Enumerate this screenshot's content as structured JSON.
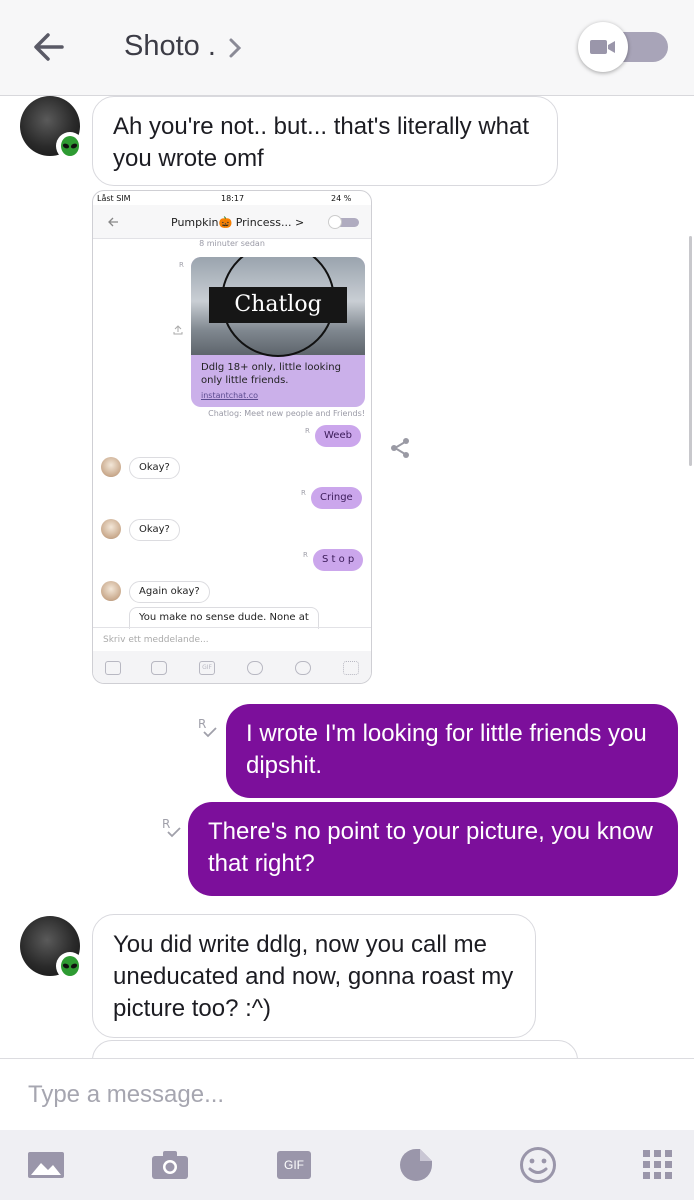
{
  "header": {
    "back_icon": "arrow-left-icon",
    "contact_name": "Shoto .",
    "chevron_icon": "chevron-right-icon",
    "video_toggle_icon": "video-camera-icon"
  },
  "messages": [
    {
      "side": "incoming",
      "text": "Ah you're not.. but... that's literally what you wrote omf"
    },
    {
      "side": "outgoing",
      "text": "I wrote I'm looking for little friends you dipshit."
    },
    {
      "side": "outgoing",
      "text": "There's no point to your picture, you know that right?"
    },
    {
      "side": "incoming",
      "text": "You did write ddlg, now you call me uneducated and now, gonna roast my picture too? :^)"
    }
  ],
  "embedded_screenshot": {
    "status_left": "Låst SIM",
    "status_time": "18:17",
    "status_battery": "24 %",
    "title": "Pumpkin🎃 Princess... >",
    "time_label": "8 minuter sedan",
    "card_logo": "Chatlog",
    "card_caption": "Ddlg 18+ only, little looking only little friends.",
    "card_link": "instantchat.co",
    "card_subtitle": "Chatlog: Meet new people and Friends!",
    "chat": [
      {
        "side": "out",
        "text": "Weeb"
      },
      {
        "side": "in",
        "text": "Okay?"
      },
      {
        "side": "out",
        "text": "Cringe"
      },
      {
        "side": "in",
        "text": "Okay?"
      },
      {
        "side": "out",
        "text": "S t o p"
      },
      {
        "side": "in",
        "text": "Again okay?"
      },
      {
        "side": "in",
        "text": "You make no sense dude. None at"
      }
    ],
    "input_placeholder": "Skriv ett meddelande...",
    "gif_label": "GIF"
  },
  "read_mark": "R",
  "composer": {
    "placeholder": "Type a message..."
  },
  "toolbar": {
    "gif_label": "GIF",
    "icons": [
      "image-icon",
      "camera-icon",
      "gif-icon",
      "sticker-icon",
      "emoji-icon",
      "apps-grid-icon"
    ]
  },
  "colors": {
    "outgoing_bubble": "#7c0f9b",
    "header_bg": "#f7f7f8",
    "toolbar_bg": "#efeff3"
  }
}
